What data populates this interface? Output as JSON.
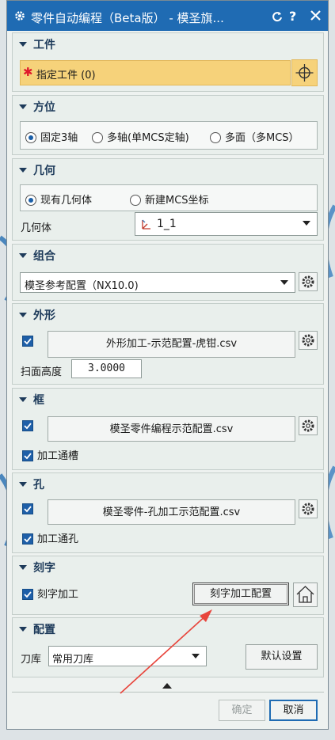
{
  "window": {
    "title": "零件自动编程（Beta版） - 模圣旗...",
    "help": "?"
  },
  "workpiece": {
    "header": "工件",
    "required_mark": "✱",
    "select_label": "指定工件 (0)"
  },
  "orientation": {
    "header": "方位",
    "options": [
      "固定3轴",
      "多轴(单MCS定轴)",
      "多面（多MCS）"
    ],
    "selected": 0
  },
  "geometry": {
    "header": "几何",
    "options": [
      "现有几何体",
      "新建MCS坐标"
    ],
    "selected": 0,
    "field_label": "几何体",
    "field_value": "1_1"
  },
  "combination": {
    "header": "组合",
    "value": "模圣参考配置（NX10.0)"
  },
  "outline": {
    "header": "外形",
    "checked": true,
    "file": "外形加工-示范配置-虎钳.csv",
    "scan_label": "扫面高度",
    "scan_value": "3.0000"
  },
  "frame": {
    "header": "框",
    "checked": true,
    "file": "模圣零件编程示范配置.csv",
    "option_label": "加工通槽",
    "option_checked": true
  },
  "hole": {
    "header": "孔",
    "checked": true,
    "file": "模圣零件-孔加工示范配置.csv",
    "option_label": "加工通孔",
    "option_checked": true
  },
  "engrave": {
    "header": "刻字",
    "check_label": "刻字加工",
    "checked": true,
    "config_button": "刻字加工配置"
  },
  "config": {
    "header": "配置",
    "tool_label": "刀库",
    "tool_value": "常用刀库",
    "default_button": "默认设置"
  },
  "footer": {
    "ok": "确定",
    "cancel": "取消"
  },
  "colors": {
    "titlebar": "#1f6bb3",
    "required": "#e0192b",
    "highlight": "#f6d27a",
    "arrow": "#e8453c"
  }
}
